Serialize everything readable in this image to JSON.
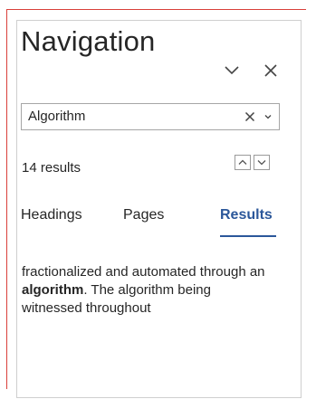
{
  "pane": {
    "title": "Navigation"
  },
  "icons": {
    "pane_options": "chevron-down-icon",
    "close": "close-icon",
    "clear_search": "close-icon",
    "search_options": "chevron-down-icon",
    "previous_result": "chevron-up-icon",
    "next_result": "chevron-down-icon"
  },
  "search": {
    "value": "Algorithm",
    "placeholder": ""
  },
  "results": {
    "count_label": "14 results"
  },
  "tabs": [
    {
      "label": "Headings",
      "active": false
    },
    {
      "label": "Pages",
      "active": false
    },
    {
      "label": "Results",
      "active": true
    }
  ],
  "result_snippet": {
    "before": "fractionalized and automated through an ",
    "highlight": "algorithm",
    "after": ". The algorithm being witnessed throughout"
  },
  "colors": {
    "accent": "#2b579a",
    "frame_edge": "#d9403a",
    "border": "#cfcfcf"
  }
}
